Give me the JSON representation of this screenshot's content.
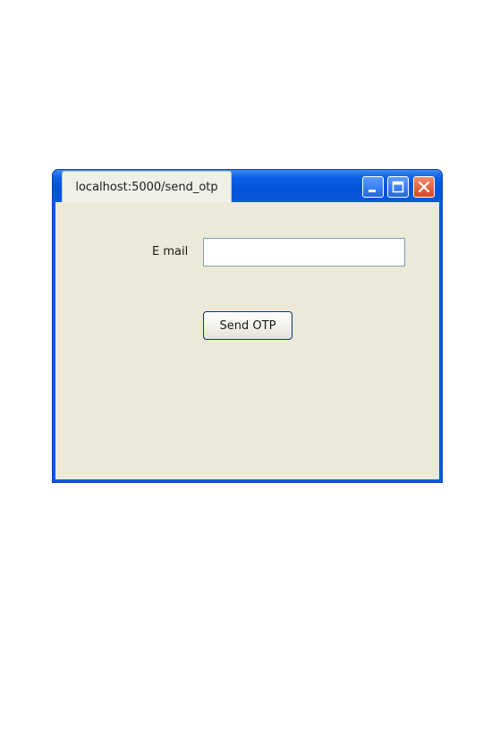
{
  "window": {
    "tab_title": "localhost:5000/send_otp",
    "controls": {
      "minimize_icon": "minimize-icon",
      "maximize_icon": "maximize-icon",
      "close_icon": "close-icon"
    },
    "colors": {
      "frame": "#0a5ae0",
      "client_background": "#ece9d8",
      "close_button": "#d4481e"
    }
  },
  "form": {
    "email_label": "E mail",
    "email_value": "",
    "email_placeholder": "",
    "send_button_label": "Send OTP"
  }
}
